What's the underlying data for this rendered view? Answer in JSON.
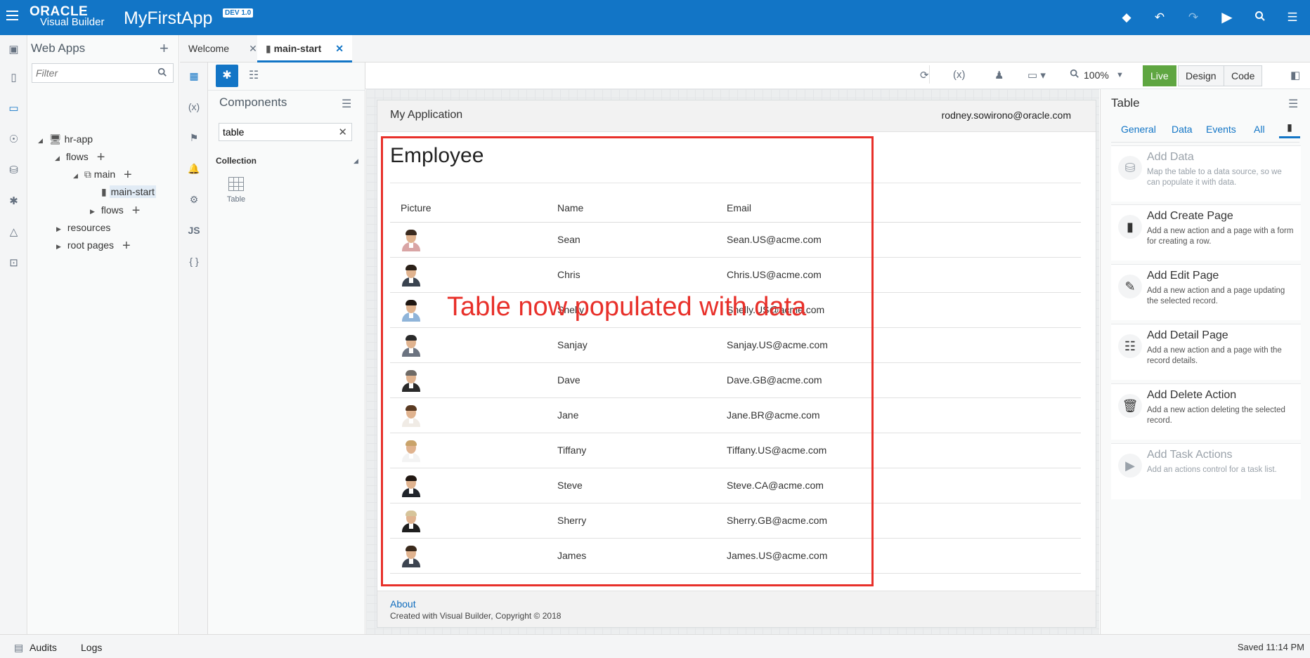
{
  "topbar": {
    "brand_line1": "ORACLE",
    "brand_line2": "Visual Builder",
    "app_title": "MyFirstApp",
    "version_badge": "DEV 1.0",
    "icons": [
      "menu-icon",
      "git-icon",
      "undo-icon",
      "redo-icon",
      "run-icon",
      "search-icon",
      "panel-menu-icon"
    ]
  },
  "navigator": {
    "title": "Web Apps",
    "filter_placeholder": "Filter",
    "tree": [
      {
        "label": "hr-app"
      },
      {
        "label": "flows"
      },
      {
        "label": "main"
      },
      {
        "label": "main-start"
      },
      {
        "label": "flows"
      },
      {
        "label": "resources"
      },
      {
        "label": "root pages"
      }
    ]
  },
  "tabs": [
    {
      "label": "Welcome"
    },
    {
      "label": "main-start"
    }
  ],
  "palette": {
    "title": "Components",
    "search_value": "table",
    "section": "Collection",
    "items": [
      {
        "label": "Table"
      }
    ]
  },
  "canvas_toolbar": {
    "zoom": "100%",
    "modes": [
      "Live",
      "Design",
      "Code"
    ]
  },
  "app": {
    "header_title": "My Application",
    "user": "rodney.sowirono@oracle.com",
    "page_title": "Employee",
    "columns": [
      "Picture",
      "Name",
      "Email"
    ],
    "rows": [
      {
        "name": "Sean",
        "email": "Sean.US@acme.com"
      },
      {
        "name": "Chris",
        "email": "Chris.US@acme.com"
      },
      {
        "name": "Shelly",
        "email": "Shelly.US@acme.com"
      },
      {
        "name": "Sanjay",
        "email": "Sanjay.US@acme.com"
      },
      {
        "name": "Dave",
        "email": "Dave.GB@acme.com"
      },
      {
        "name": "Jane",
        "email": "Jane.BR@acme.com"
      },
      {
        "name": "Tiffany",
        "email": "Tiffany.US@acme.com"
      },
      {
        "name": "Steve",
        "email": "Steve.CA@acme.com"
      },
      {
        "name": "Sherry",
        "email": "Sherry.GB@acme.com"
      },
      {
        "name": "James",
        "email": "James.US@acme.com"
      }
    ],
    "footer_link": "About",
    "footer_text": "Created with Visual Builder, Copyright © 2018"
  },
  "annotation": {
    "text": "Table now populated with data",
    "color": "#e8302a"
  },
  "properties": {
    "title": "Table",
    "tabs": [
      "General",
      "Data",
      "Events",
      "All"
    ],
    "actions": [
      {
        "title": "Add Data",
        "desc": "Map the table to a data source, so we can populate it with data.",
        "icon": "add-data-icon",
        "enabled": false
      },
      {
        "title": "Add Create Page",
        "desc": "Add a new action and a page with a form for creating a row.",
        "icon": "create-page-icon",
        "enabled": true
      },
      {
        "title": "Add Edit Page",
        "desc": "Add a new action and a page updating the selected record.",
        "icon": "edit-page-icon",
        "enabled": true
      },
      {
        "title": "Add Detail Page",
        "desc": "Add a new action and a page with the record details.",
        "icon": "detail-page-icon",
        "enabled": true
      },
      {
        "title": "Add Delete Action",
        "desc": "Add a new action deleting the selected record.",
        "icon": "trash-icon",
        "enabled": true
      },
      {
        "title": "Add Task Actions",
        "desc": "Add an actions control for a task list.",
        "icon": "play-icon",
        "enabled": false
      }
    ]
  },
  "statusbar": {
    "audits": "Audits",
    "logs": "Logs",
    "saved": "Saved 11:14 PM"
  },
  "colors": {
    "brand": "#1275c6",
    "live": "#5fa641"
  }
}
